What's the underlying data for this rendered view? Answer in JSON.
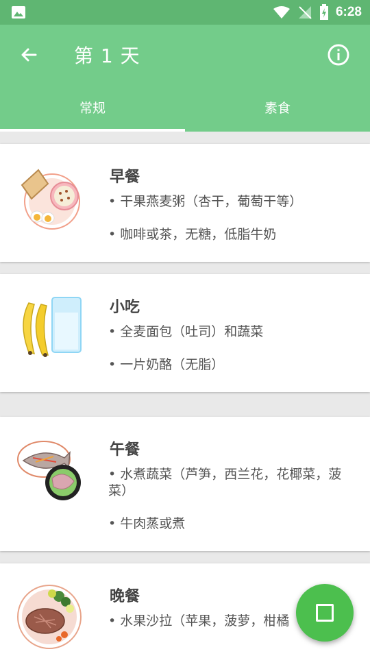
{
  "status_bar": {
    "time": "6:28"
  },
  "app_bar": {
    "title": "第 1 天"
  },
  "tabs": [
    {
      "label": "常规",
      "selected": true
    },
    {
      "label": "素食",
      "selected": false
    }
  ],
  "meals": [
    {
      "title": "早餐",
      "items": [
        "• 干果燕麦粥（杏干，葡萄干等）",
        "• 咖啡或茶，无糖，低脂牛奶"
      ],
      "icon": "breakfast-plate-icon"
    },
    {
      "title": "小吃",
      "items": [
        "• 全麦面包（吐司）和蔬菜",
        "• 一片奶酪（无脂）"
      ],
      "icon": "banana-milk-icon"
    },
    {
      "title": "午餐",
      "items": [
        "• 水煮蔬菜（芦笋，西兰花，花椰菜，菠菜）",
        "• 牛肉蒸或煮"
      ],
      "icon": "fish-meat-plate-icon"
    },
    {
      "title": "晚餐",
      "items": [
        "• 水果沙拉（苹果，菠萝，柑橘"
      ],
      "icon": "steak-salad-plate-icon"
    }
  ],
  "colors": {
    "status_bar": "#5fb672",
    "app_bar": "#73cc8a",
    "fab": "#4cbf4e"
  }
}
